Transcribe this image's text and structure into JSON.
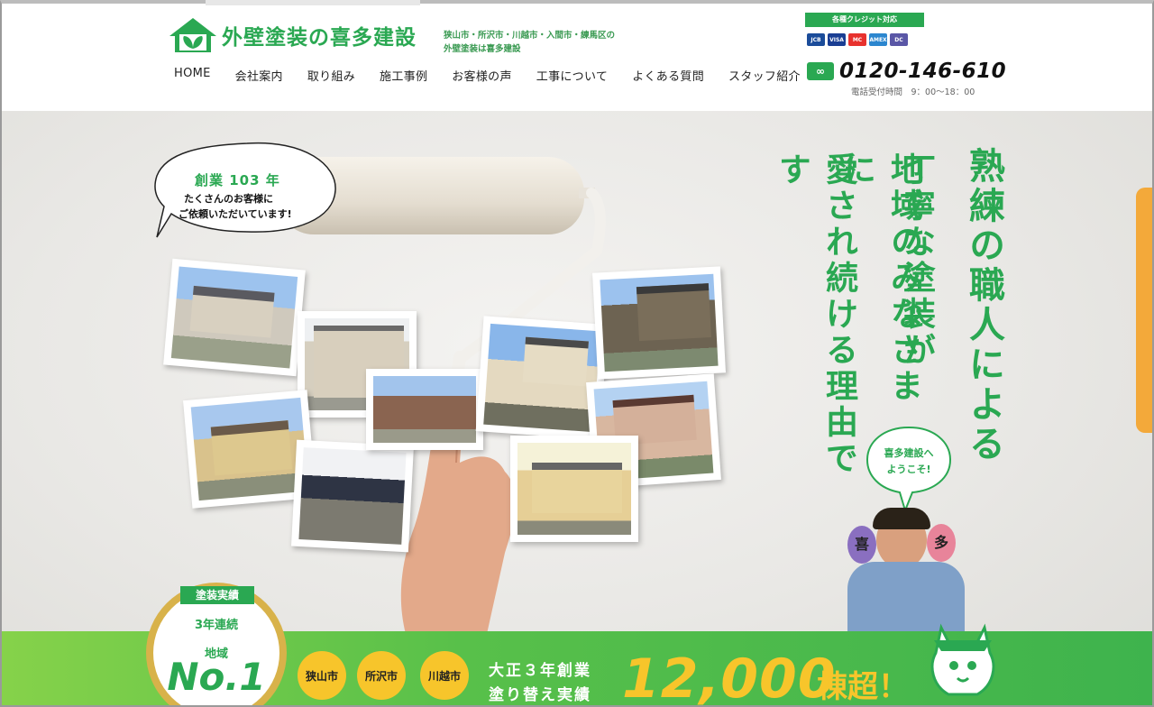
{
  "header": {
    "logo_name": "外壁塗装の喜多建設",
    "logo_sub_line1": "狭山市・所沢市・川越市・入間市・練馬区の",
    "logo_sub_line2": "外壁塗装は喜多建設",
    "nav": [
      "HOME",
      "会社案内",
      "取り組み",
      "施工事例",
      "お客様の声",
      "工事について",
      "よくある質問",
      "スタッフ紹介"
    ],
    "credit_title": "各種クレジット対応",
    "cards": [
      "JCB",
      "VISA",
      "MC",
      "AMEX",
      "DC"
    ],
    "phone": "0120-146-610",
    "phone_icon": "free-dial-icon",
    "phone_hours": "電話受付時間　9：00〜18：00"
  },
  "hero": {
    "bubble_left": {
      "line1": "創業 103 年",
      "line2": "たくさんのお客様に",
      "line3": "ご依頼いただいています!"
    },
    "vertical_copy": [
      "熟練の職人による",
      "丁寧な塗装が",
      "地域のみなさまに",
      "愛され続ける理由です"
    ],
    "bubble_right": {
      "line1": "喜多建設へ",
      "line2": "ようこそ!"
    },
    "fan_left": "喜",
    "fan_right": "多"
  },
  "banner": {
    "medal_title": "塗装実績",
    "medal_line1": "3年連続",
    "medal_line2": "地域",
    "medal_rank": "No.1",
    "cities": [
      "狭山市",
      "所沢市",
      "川越市"
    ],
    "line1": "大正３年創業",
    "line2": "塗り替え実績",
    "count": "12,000",
    "unit": "棟超！"
  },
  "colors": {
    "brand_green": "#2aa852",
    "yellow": "#f7c52b",
    "orange_tab": "#f3a93a"
  }
}
